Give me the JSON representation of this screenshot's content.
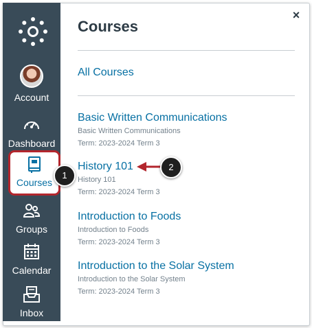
{
  "tray": {
    "title": "Courses",
    "close_symbol": "×",
    "all_courses_label": "All Courses",
    "courses": [
      {
        "name": "Basic Written Communications",
        "subtitle": "Basic Written Communications",
        "term": "Term: 2023-2024 Term 3"
      },
      {
        "name": "History 101",
        "subtitle": "History 101",
        "term": "Term: 2023-2024 Term 3"
      },
      {
        "name": "Introduction to Foods",
        "subtitle": "Introduction to Foods",
        "term": "Term: 2023-2024 Term 3"
      },
      {
        "name": "Introduction to the Solar System",
        "subtitle": "Introduction to the Solar System",
        "term": "Term: 2023-2024 Term 3"
      }
    ]
  },
  "nav": {
    "logo_icon": "canvas-logo-icon",
    "items": [
      {
        "label": "Account",
        "icon": "avatar"
      },
      {
        "label": "Dashboard",
        "icon": "dashboard-icon"
      },
      {
        "label": "Courses",
        "icon": "book-icon"
      },
      {
        "label": "Groups",
        "icon": "groups-icon"
      },
      {
        "label": "Calendar",
        "icon": "calendar-icon"
      },
      {
        "label": "Inbox",
        "icon": "inbox-icon"
      }
    ]
  },
  "callouts": {
    "badge_1": "1",
    "badge_2": "2"
  },
  "colors": {
    "nav_bg": "#394b58",
    "link": "#0770a3",
    "highlight": "#b3262d",
    "arrow": "#b3262d"
  }
}
